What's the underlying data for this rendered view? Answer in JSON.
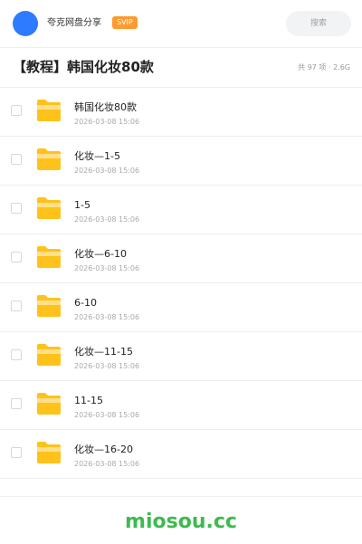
{
  "header": {
    "share_name": "夸克网盘分享",
    "badge": "SVIP",
    "search_placeholder": "搜索"
  },
  "title_row": {
    "title": "【教程】韩国化妆80款",
    "summary": "共 97 项 · 2.6G"
  },
  "files": [
    {
      "name": "韩国化妆80款",
      "time": "2026-03-08 15:06"
    },
    {
      "name": "化妆—1-5",
      "time": "2026-03-08 15:06"
    },
    {
      "name": "1-5",
      "time": "2026-03-08 15:06"
    },
    {
      "name": "化妆—6-10",
      "time": "2026-03-08 15:06"
    },
    {
      "name": "6-10",
      "time": "2026-03-08 15:06"
    },
    {
      "name": "化妆—11-15",
      "time": "2026-03-08 15:06"
    },
    {
      "name": "11-15",
      "time": "2026-03-08 15:06"
    },
    {
      "name": "化妆—16-20",
      "time": "2026-03-08 15:06"
    }
  ],
  "footer": {
    "brand": "miosou.cc"
  },
  "colors": {
    "avatar": "#2f7bff",
    "badge": "#ff9a2e",
    "folder": "#ffc21a",
    "brand": "#3dbb4f"
  }
}
